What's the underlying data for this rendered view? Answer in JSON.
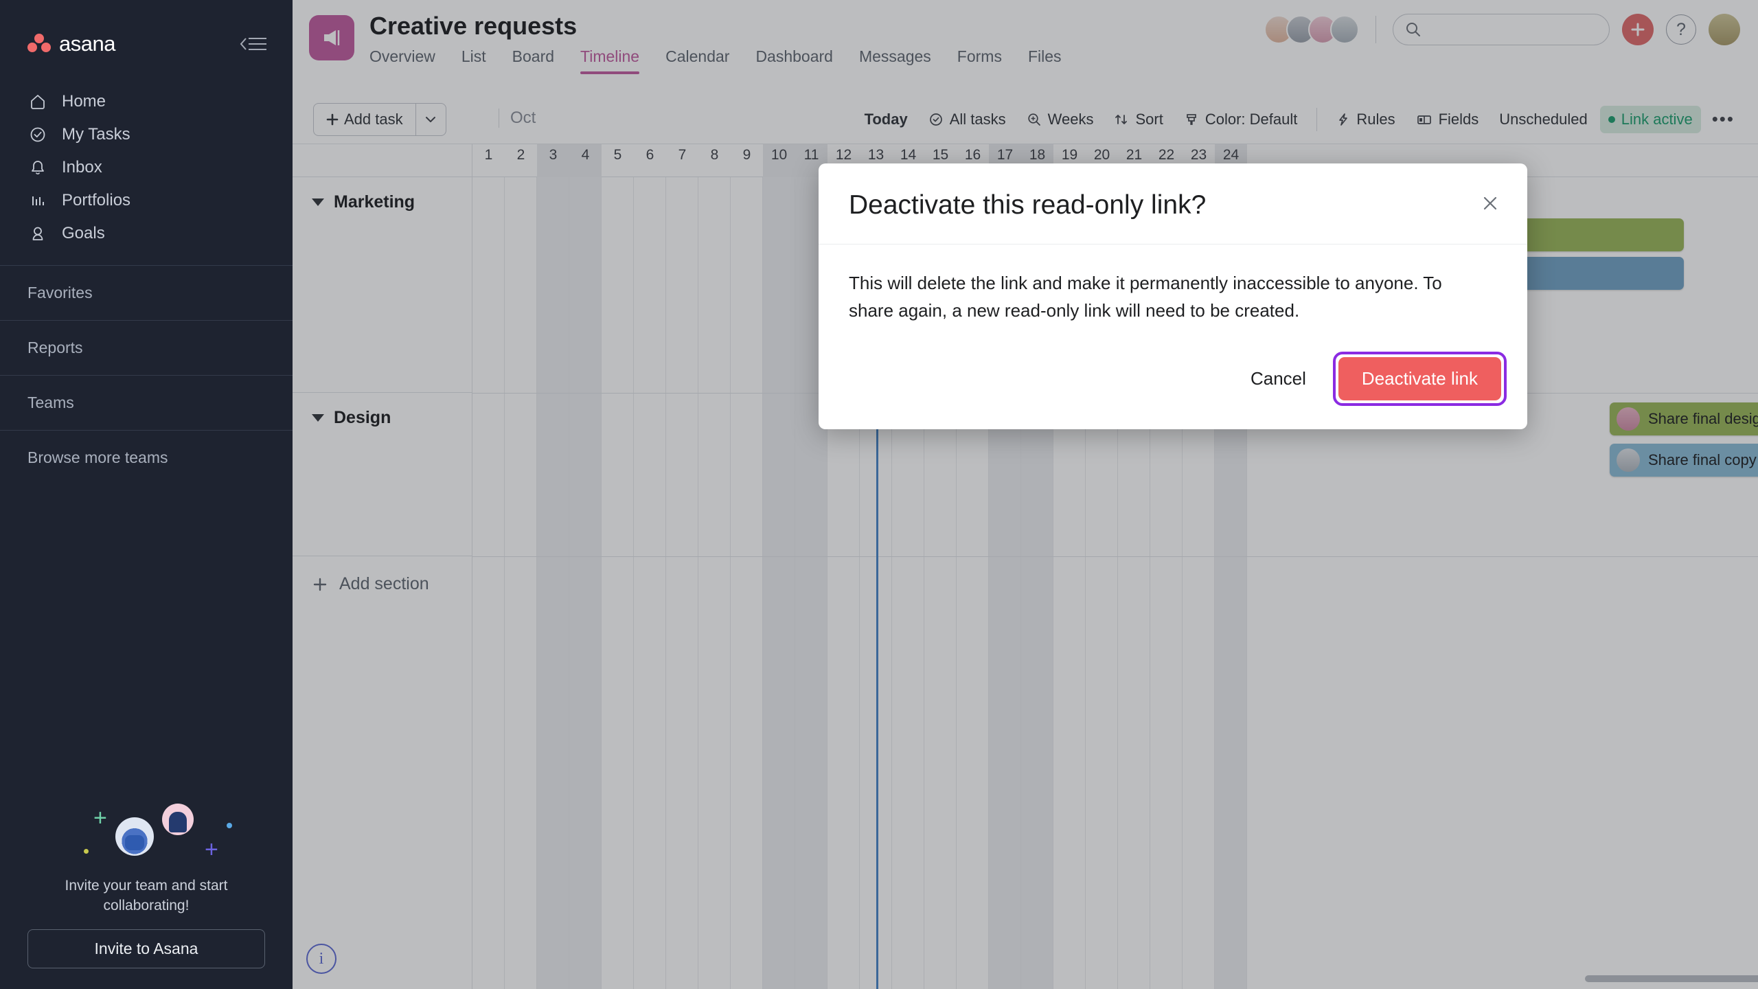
{
  "sidebar": {
    "brand": "asana",
    "collapse_icon": "collapse-sidebar-icon",
    "nav": [
      {
        "label": "Home",
        "icon": "home-icon"
      },
      {
        "label": "My Tasks",
        "icon": "check-circle-icon"
      },
      {
        "label": "Inbox",
        "icon": "bell-icon"
      },
      {
        "label": "Portfolios",
        "icon": "bar-chart-icon"
      },
      {
        "label": "Goals",
        "icon": "goal-icon"
      }
    ],
    "sections": [
      {
        "label": "Favorites"
      },
      {
        "label": "Reports"
      },
      {
        "label": "Teams"
      },
      {
        "label": "Browse more teams"
      }
    ],
    "invite": {
      "text": "Invite your team and start collaborating!",
      "button": "Invite to Asana"
    }
  },
  "header": {
    "project_icon": "megaphone-icon",
    "title": "Creative requests",
    "tabs": [
      {
        "label": "Overview",
        "active": false
      },
      {
        "label": "List",
        "active": false
      },
      {
        "label": "Board",
        "active": false
      },
      {
        "label": "Timeline",
        "active": true
      },
      {
        "label": "Calendar",
        "active": false
      },
      {
        "label": "Dashboard",
        "active": false
      },
      {
        "label": "Messages",
        "active": false
      },
      {
        "label": "Forms",
        "active": false
      },
      {
        "label": "Files",
        "active": false
      }
    ],
    "search": {
      "placeholder": "",
      "value": "",
      "icon": "search-icon"
    },
    "add_button_icon": "plus-icon",
    "help_button": "?",
    "member_count": 4
  },
  "toolbar": {
    "add_task": "Add task",
    "add_task_caret": "chevron-down-icon",
    "month": "Oct",
    "today": "Today",
    "all_tasks": "All tasks",
    "weeks": "Weeks",
    "sort": "Sort",
    "color": "Color: Default",
    "rules": "Rules",
    "fields": "Fields",
    "unscheduled": "Unscheduled",
    "link_active": "Link active",
    "link_active_color": "#1c9e6e",
    "more": "•••"
  },
  "timeline": {
    "days": [
      "1",
      "2",
      "3",
      "4",
      "5",
      "6",
      "7",
      "8",
      "9",
      "10",
      "11",
      "12",
      "13",
      "14",
      "15",
      "16",
      "17",
      "18",
      "19",
      "20",
      "21",
      "22",
      "23",
      "24"
    ],
    "weekend_days": [
      "3",
      "4",
      "10",
      "11",
      "17",
      "18",
      "24"
    ],
    "today_day": "13",
    "sections": [
      {
        "name": "Marketing"
      },
      {
        "name": "Design"
      }
    ],
    "add_section": "Add section",
    "tasks": [
      {
        "label": "",
        "color": "#9ab75a",
        "section": "Marketing",
        "row": 0
      },
      {
        "label": "",
        "color": "#71a3c4",
        "section": "Marketing",
        "row": 1
      },
      {
        "label": "Share final design",
        "color": "#9ab75a",
        "section": "Design",
        "row": 0
      },
      {
        "label": "Share final copy",
        "color": "#8cbcd6",
        "section": "Design",
        "row": 1
      }
    ],
    "info_icon": "info-icon"
  },
  "modal": {
    "title": "Deactivate this read-only link?",
    "close_icon": "close-icon",
    "body": "This will delete the link and make it permanently inaccessible to anyone. To share again, a new read-only link will need to be created.",
    "cancel": "Cancel",
    "confirm": "Deactivate link",
    "confirm_color": "#ef5f5f",
    "focus_ring_color": "#8B2BE2"
  }
}
